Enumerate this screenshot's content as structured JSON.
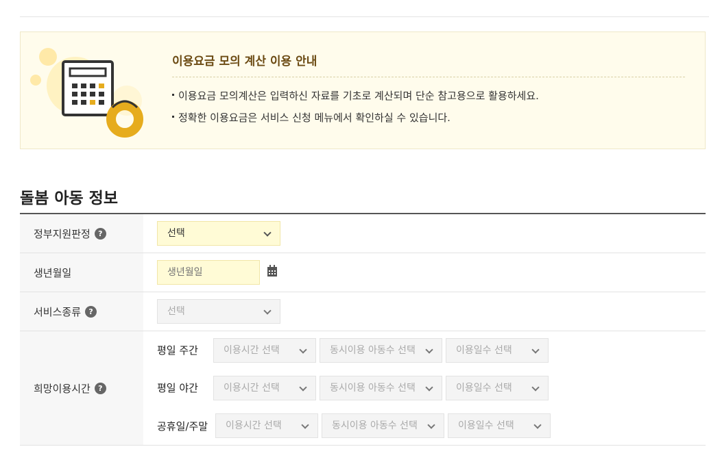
{
  "notice": {
    "title": "이용요금 모의 계산 이용 안내",
    "lines": [
      "이용요금 모의계산은 입력하신 자료를 기초로 계산되며 단순 참고용으로 활용하세요.",
      "정확한 이용요금은 서비스 신청 메뉴에서 확인하실 수 있습니다."
    ],
    "illustration_icon": "calculator-icon"
  },
  "section": {
    "title": "돌봄 아동 정보"
  },
  "form": {
    "gov_support": {
      "label": "정부지원판정",
      "help": "?",
      "value": "선택"
    },
    "birth": {
      "label": "생년월일",
      "placeholder": "생년월일",
      "icon": "calendar-icon"
    },
    "service_type": {
      "label": "서비스종류",
      "help": "?",
      "value": "선택"
    },
    "desired_time": {
      "label": "희망이용시간",
      "help": "?",
      "periods": [
        {
          "label": "평일 주간",
          "time": "이용시간 선택",
          "children": "동시이용 아동수 선택",
          "days": "이용일수 선택"
        },
        {
          "label": "평일 야간",
          "time": "이용시간 선택",
          "children": "동시이용 아동수 선택",
          "days": "이용일수 선택"
        },
        {
          "label": "공휴일/주말",
          "time": "이용시간 선택",
          "children": "동시이용 아동수 선택",
          "days": "이용일수 선택"
        }
      ]
    }
  },
  "colors": {
    "accent_yellow": "#fffbd6",
    "brand_gold": "#e6ac1e",
    "notice_bg": "#fffcec"
  }
}
